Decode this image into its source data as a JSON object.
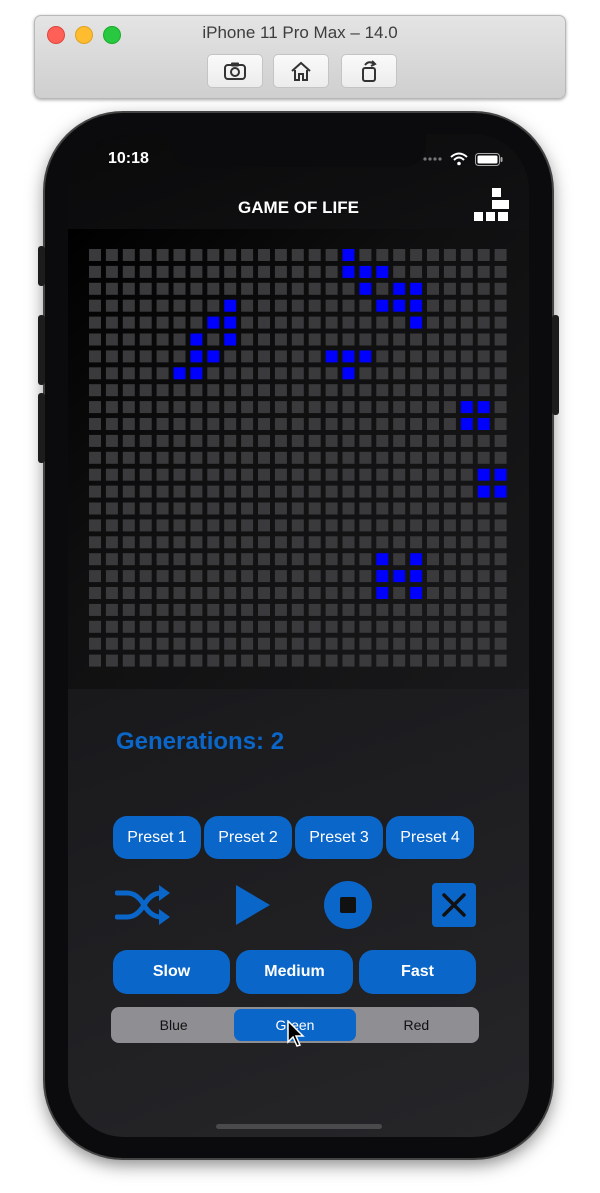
{
  "simulator": {
    "title": "iPhone 11 Pro Max – 14.0",
    "buttons": [
      "screenshot-icon",
      "home-icon",
      "rotate-icon"
    ]
  },
  "status": {
    "time": "10:18"
  },
  "nav": {
    "title": "GAME OF LIFE",
    "icon": "blocks-icon"
  },
  "board": {
    "rows": 25,
    "cols": 25,
    "live_color": "#0000ff",
    "dead_color": "#3a3a3c",
    "live_cells": [
      [
        0,
        15
      ],
      [
        1,
        15
      ],
      [
        1,
        16
      ],
      [
        1,
        17
      ],
      [
        2,
        16
      ],
      [
        2,
        18
      ],
      [
        2,
        19
      ],
      [
        3,
        17
      ],
      [
        3,
        18
      ],
      [
        3,
        19
      ],
      [
        4,
        19
      ],
      [
        3,
        8
      ],
      [
        4,
        7
      ],
      [
        4,
        8
      ],
      [
        5,
        6
      ],
      [
        5,
        8
      ],
      [
        6,
        6
      ],
      [
        6,
        7
      ],
      [
        7,
        5
      ],
      [
        7,
        6
      ],
      [
        6,
        14
      ],
      [
        6,
        15
      ],
      [
        6,
        16
      ],
      [
        7,
        15
      ],
      [
        9,
        22
      ],
      [
        9,
        23
      ],
      [
        10,
        22
      ],
      [
        10,
        23
      ],
      [
        13,
        23
      ],
      [
        13,
        24
      ],
      [
        14,
        23
      ],
      [
        14,
        24
      ],
      [
        18,
        17
      ],
      [
        18,
        19
      ],
      [
        19,
        17
      ],
      [
        19,
        18
      ],
      [
        19,
        19
      ],
      [
        20,
        17
      ],
      [
        20,
        19
      ]
    ]
  },
  "generations": {
    "label": "Generations: 2"
  },
  "presets": [
    "Preset 1",
    "Preset 2",
    "Preset 3",
    "Preset 4"
  ],
  "controls": [
    "shuffle-icon",
    "play-icon",
    "stop-icon",
    "clear-icon"
  ],
  "speeds": [
    "Slow",
    "Medium",
    "Fast"
  ],
  "color_picker": {
    "options": [
      "Blue",
      "Green",
      "Red"
    ],
    "selected": "Green"
  },
  "accent": "#0a66c8"
}
